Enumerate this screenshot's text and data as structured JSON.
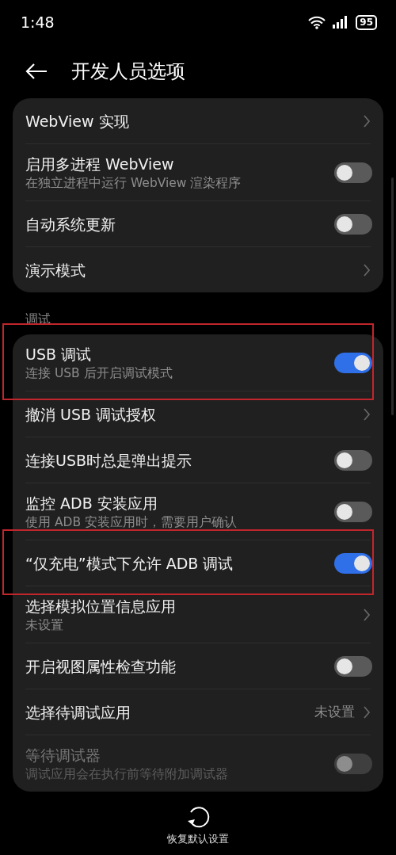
{
  "status_bar": {
    "time": "1:48",
    "battery": "95"
  },
  "header": {
    "title": "开发人员选项"
  },
  "sections": [
    {
      "items": [
        {
          "kind": "link",
          "title": "WebView 实现"
        },
        {
          "kind": "toggle",
          "title": "启用多进程 WebView",
          "subtitle": "在独立进程中运行 WebView 渲染程序",
          "on": false
        },
        {
          "kind": "toggle",
          "title": "自动系统更新",
          "on": false
        },
        {
          "kind": "link",
          "title": "演示模式"
        }
      ]
    },
    {
      "label": "调试",
      "items": [
        {
          "kind": "toggle",
          "title": "USB 调试",
          "subtitle": "连接 USB 后开启调试模式",
          "on": true,
          "highlighted": true
        },
        {
          "kind": "link",
          "title": "撤消 USB 调试授权"
        },
        {
          "kind": "toggle",
          "title": "连接USB时总是弹出提示",
          "on": false
        },
        {
          "kind": "toggle",
          "title": "监控 ADB 安装应用",
          "subtitle": "使用 ADB 安装应用时，需要用户确认",
          "on": false
        },
        {
          "kind": "toggle",
          "title": "“仅充电”模式下允许 ADB 调试",
          "on": true,
          "highlighted": true
        },
        {
          "kind": "link",
          "title": "选择模拟位置信息应用",
          "subtitle": "未设置"
        },
        {
          "kind": "toggle",
          "title": "开启视图属性检查功能",
          "on": false
        },
        {
          "kind": "link",
          "title": "选择待调试应用",
          "value": "未设置"
        },
        {
          "kind": "toggle",
          "title": "等待调试器",
          "subtitle": "调试应用会在执行前等待附加调试器",
          "on": false,
          "disabled": true
        }
      ]
    }
  ],
  "footer": {
    "label": "恢复默认设置"
  }
}
